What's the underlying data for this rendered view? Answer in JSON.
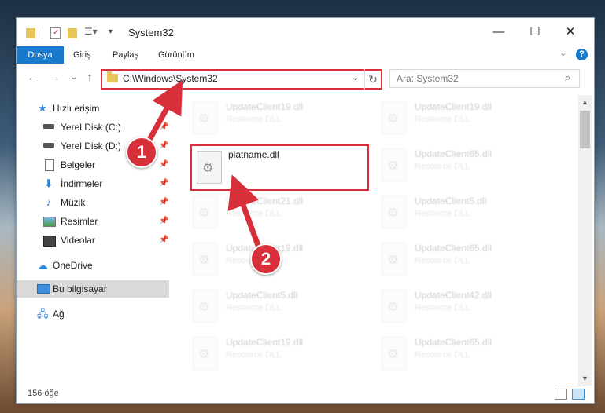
{
  "window": {
    "title": "System32",
    "quick_access_icons": [
      "folder-icon",
      "properties-icon",
      "new-folder-icon",
      "customize-toolbar-icon"
    ]
  },
  "ribbon": {
    "tabs": [
      "Dosya",
      "Giriş",
      "Paylaş",
      "Görünüm"
    ],
    "active_tab": "Dosya",
    "help": "?"
  },
  "navigation": {
    "address_path": "C:\\Windows\\System32",
    "search_placeholder": "Ara: System32"
  },
  "sidebar": {
    "quick_access": "Hızlı erişim",
    "items": [
      {
        "label": "Yerel Disk (C:)",
        "icon": "drive-icon",
        "pinned": true
      },
      {
        "label": "Yerel Disk (D:)",
        "icon": "drive-icon",
        "pinned": true
      },
      {
        "label": "Belgeler",
        "icon": "documents-icon",
        "pinned": true
      },
      {
        "label": "İndirmeler",
        "icon": "downloads-icon",
        "pinned": true
      },
      {
        "label": "Müzik",
        "icon": "music-icon",
        "pinned": true
      },
      {
        "label": "Resimler",
        "icon": "pictures-icon",
        "pinned": true
      },
      {
        "label": "Videolar",
        "icon": "videos-icon",
        "pinned": true
      }
    ],
    "onedrive": "OneDrive",
    "this_pc": "Bu bilgisayar",
    "network": "Ağ"
  },
  "files": {
    "highlighted": {
      "name": "platname.dll"
    },
    "left_column": [
      {
        "name": "UpdateClient19.dll",
        "type": "Resource DLL"
      },
      {
        "name": "UpdateClient21.dll",
        "type": "Resource DLL"
      },
      {
        "name": "UpdateClient19.dll",
        "type": "Resource DLL"
      },
      {
        "name": "UpdateClient5.dll",
        "type": "Resource DLL"
      },
      {
        "name": "UpdateClient19.dll",
        "type": "Resource DLL"
      }
    ],
    "right_column": [
      {
        "name": "UpdateClient19.dll",
        "type": "Resource DLL"
      },
      {
        "name": "UpdateClient65.dll",
        "type": "Resource DLL"
      },
      {
        "name": "UpdateClient5.dll",
        "type": "Resource DLL"
      },
      {
        "name": "UpdateClient65.dll",
        "type": "Resource DLL"
      },
      {
        "name": "UpdateClient42.dll",
        "type": "Resource DLL"
      },
      {
        "name": "UpdateClient65.dll",
        "type": "Resource DLL"
      }
    ]
  },
  "status": {
    "item_count": "156 öğe"
  },
  "callouts": {
    "step1": "1",
    "step2": "2",
    "color": "#d8303a"
  }
}
